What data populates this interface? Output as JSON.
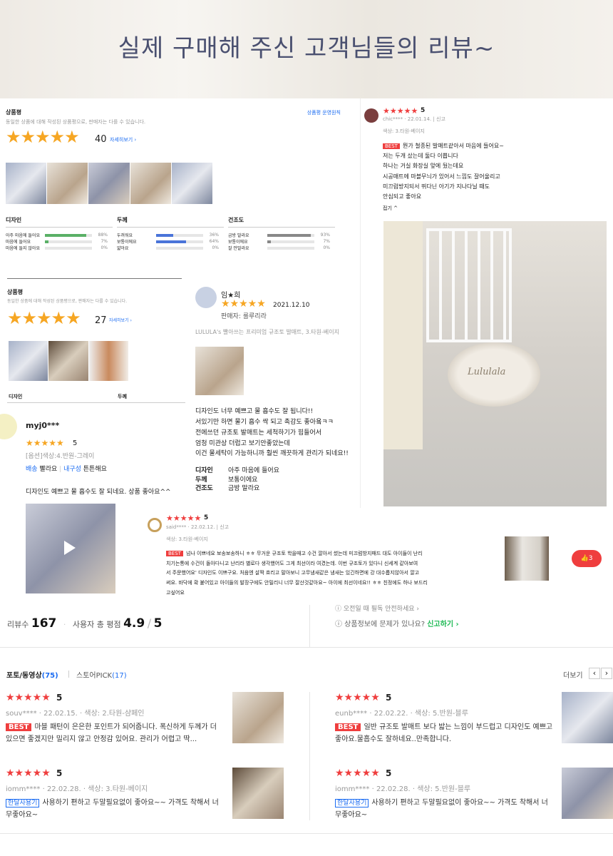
{
  "header": {
    "title": "실제 구매해 주신 고객님들의 리뷰~"
  },
  "panel1": {
    "heading": "상품평",
    "policy_link": "상품평 운영원칙",
    "desc": "동일한 상품에 대해 작성된 상품평으로, 판매자는 다를 수 있습니다.",
    "stars": "★★★★★",
    "count": "40",
    "more": "자세히보기 ›",
    "groups": [
      {
        "title": "디자인",
        "rows": [
          {
            "label": "아주 마음에 들어요",
            "pct": "88%",
            "value": 0.88,
            "color": "#5ab066"
          },
          {
            "label": "마음에 들어요",
            "pct": "7%",
            "value": 0.07,
            "color": "#5ab066"
          },
          {
            "label": "마음에 들지 않아요",
            "pct": "0%",
            "value": 0.0,
            "color": "#5ab066"
          }
        ]
      },
      {
        "title": "두께",
        "rows": [
          {
            "label": "두꺼워요",
            "pct": "36%",
            "value": 0.36,
            "color": "#4a74d9"
          },
          {
            "label": "보통이에요",
            "pct": "64%",
            "value": 0.64,
            "color": "#4a74d9"
          },
          {
            "label": "얇아요",
            "pct": "0%",
            "value": 0.0,
            "color": "#4a74d9"
          }
        ]
      },
      {
        "title": "건조도",
        "rows": [
          {
            "label": "금방 말라요",
            "pct": "93%",
            "value": 0.93,
            "color": "#888888"
          },
          {
            "label": "보통이에요",
            "pct": "7%",
            "value": 0.07,
            "color": "#888888"
          },
          {
            "label": "잘 안말라요",
            "pct": "0%",
            "value": 0.0,
            "color": "#888888"
          }
        ]
      }
    ]
  },
  "panel2": {
    "heading": "상품평",
    "desc": "동일한 상품에 대해 작성된 상품평으로, 판매자는 다를 수 있습니다.",
    "stars": "★★★★★",
    "count": "27",
    "more": "자세히보기 ›",
    "col1": "디자인",
    "col2": "두께",
    "reviewer": "myj0***",
    "rating": "5",
    "option": "[옵션]색상:4.반원-그레이",
    "tag1_label": "배송",
    "tag1_value": "빨라요",
    "tag2_label": "내구성",
    "tag2_value": "튼튼해요",
    "text": "디자인도 예쁘고 물 흡수도 잘 되네요. 상품 좋아요^^",
    "play_icon": "play-icon"
  },
  "panel3": {
    "reviewer": "임★희",
    "date": "2021.12.10",
    "seller": "판매자: 룰루리라",
    "product": "LULULA's 빨아쓰는 프리미엄 규조토 발매트, 3.타원-베이지",
    "lines": [
      "디자인도 너무 예쁘고 물 흡수도 잘 됩니다!!",
      "서있기만 하면 물기 흡수 싹 되고 촉감도 좋아욬ㅋㅋ",
      "전에쓰던 규조토 발매트는 세척하기가 힘들어서",
      "엄청 미관상 더럽고 보기안좋았는데",
      "이건 물세탁이 가능하니까 훨씬 깨끗하게 관리가 되네요!!"
    ],
    "attrs": [
      {
        "k": "디자인",
        "v": "아주 마음에 들어요"
      },
      {
        "k": "두께",
        "v": "보통이에요"
      },
      {
        "k": "건조도",
        "v": "금방 말라요"
      }
    ]
  },
  "panel4": {
    "rating": "5",
    "user": "chic****",
    "date": "22.01.14.",
    "report": "신고",
    "option": "색상: 3.타원-베이지",
    "best": "BEST",
    "lines": [
      "뭔가 철종된 발매트같아서 마음에 들어요~",
      "저는 두개 샀는데 둘다 이쁩니다",
      "하나는 거실 화장실 앞에 뒀는데요",
      "시공매트에 마블무늬가 있어서 느낌도 잘어울리고",
      "미끄럼방지되서 뛰다닌 아기가 지나다닐 때도",
      "안심되고 좋아요"
    ],
    "fold": "접기 ^",
    "mat_text": "Lululala"
  },
  "panel5": {
    "rating": "5",
    "user": "said****",
    "date": "22.02.12.",
    "report": "신고",
    "option": "색상: 3.타원-베이지",
    "best": "BEST",
    "lines": [
      "넘나 이쁘네요 보송보송하니 ㅎㅎ 무거운 규조토 학을때고 수건 깔아서 썼는데 미끄럼방지패드 대도 아이들이 난리",
      "치기는통에 수건이 돌아다니고 난리라 별로다 생각했어도 그게 최선이라 여겼는데. 이번 규조토가 있다니 신세계 같아보여",
      "서 주문했어요' 디자인도 이쁘구요. 처음엔 살짝 흐리고 말아보니 고무냄새같은 냄새는 있긴하면에 강 대수롭지않아서 깔고",
      "써요. 바닥에 확 붙어있고 아이들의 발장구에도 안밀리니 너무 잘산것같아요~ 아이에 최선이네요!! ㅎㅎ 친정에도 하나 보드리",
      "고싶어요"
    ],
    "like_count": "3"
  },
  "summary": {
    "review_label": "리뷰수",
    "review_count": "167",
    "score_label": "사용자 총 평점",
    "score": "4.9",
    "max": "5",
    "right1": "ⓘ 오전일 때 필독 안전하세요 ›",
    "right2_prefix": "ⓘ 상품정보에 문제가 있나요?",
    "right2_link": "신고하기 ›"
  },
  "tabs": {
    "photo_label": "포토/동영상",
    "photo_count": "(75)",
    "store_label": "스토어PICK",
    "store_count": "(17)",
    "more": "더보기",
    "prev": "‹",
    "next": "›"
  },
  "reviews": [
    {
      "rating": "5",
      "user": "souv****",
      "date": "22.02.15.",
      "option": "색상: 2.타원-샴페인",
      "badge": "BEST",
      "badge_type": "best",
      "text": "마블 패턴이 은은한 포인트가 되어줍니다. 폭신하게 두께가 더 있으면 좋겠지만 밀리지 않고 안정감 있어요. 관리가 어렵고 딱..."
    },
    {
      "rating": "5",
      "user": "eunb****",
      "date": "22.02.22.",
      "option": "색상: 5.반원-블루",
      "badge": "BEST",
      "badge_type": "best",
      "text": "일반 규조토 발매트 보다 밟는 느낌이 부드럽고 디자인도 예쁘고 좋아요.물흡수도 잘하네요..만족합니다."
    },
    {
      "rating": "5",
      "user": "iomm****",
      "date": "22.02.28.",
      "option": "색상: 3.타원-베이지",
      "badge": "한달사용기",
      "badge_type": "month",
      "text": "사용하기 편하고 두말필요없이 좋아요~~ 가격도 착해서 너무좋아요~"
    },
    {
      "rating": "5",
      "user": "iomm****",
      "date": "22.02.28.",
      "option": "색상: 5.반원-블루",
      "badge": "한달사용기",
      "badge_type": "month",
      "text": "사용하기 편하고 두말필요없이 좋아요~~ 가격도 착해서 너무좋아요~"
    }
  ],
  "colors": {
    "accent_red": "#ef3e3e",
    "star": "#f6a623",
    "title": "#4a5070",
    "link_green": "#1db954",
    "link_blue": "#1b6cf2"
  }
}
